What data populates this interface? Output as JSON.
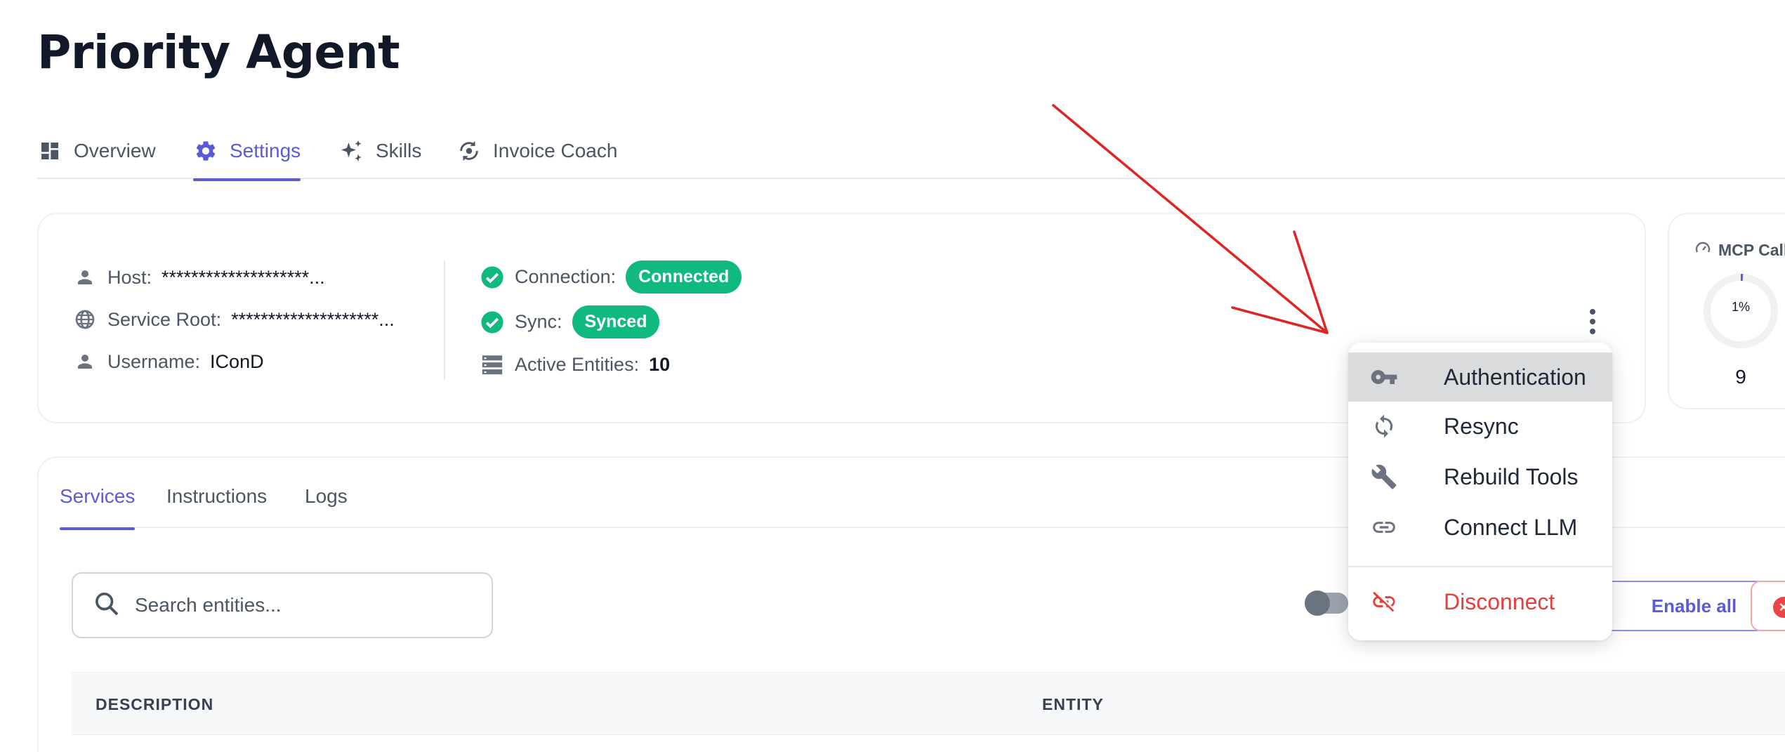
{
  "page": {
    "title": "Priority Agent"
  },
  "top_tabs": [
    {
      "label": "Overview",
      "icon": "dashboard-icon"
    },
    {
      "label": "Settings",
      "icon": "gear-icon",
      "active": true
    },
    {
      "label": "Skills",
      "icon": "sparkles-icon"
    },
    {
      "label": "Invoice Coach",
      "icon": "coach-icon"
    }
  ],
  "info": {
    "host_label": "Host:",
    "host_value": "********************...",
    "service_root_label": "Service Root:",
    "service_root_value": "********************...",
    "username_label": "Username:",
    "username_value": "IConD",
    "connection_label": "Connection:",
    "connection_status": "Connected",
    "sync_label": "Sync:",
    "sync_status": "Synced",
    "active_entities_label": "Active Entities:",
    "active_entities_value": "10"
  },
  "mcp": {
    "title": "MCP Call",
    "gauge_percent": "1%",
    "gauge_fraction": 0.01,
    "count": "9"
  },
  "menu": {
    "items": [
      {
        "label": "Authentication",
        "icon": "key-icon"
      },
      {
        "label": "Resync",
        "icon": "sync-icon"
      },
      {
        "label": "Rebuild Tools",
        "icon": "wrench-icon"
      },
      {
        "label": "Connect LLM",
        "icon": "link-icon"
      },
      {
        "label": "Disconnect",
        "icon": "link-off-icon"
      }
    ]
  },
  "sub_tabs": [
    {
      "label": "Services",
      "active": true
    },
    {
      "label": "Instructions"
    },
    {
      "label": "Logs"
    }
  ],
  "search": {
    "placeholder": "Search entities..."
  },
  "actions": {
    "enable_all": "Enable all"
  },
  "table": {
    "columns": [
      "DESCRIPTION",
      "ENTITY"
    ]
  },
  "colors": {
    "accent": "#5b5bd6",
    "success": "#10b981",
    "danger": "#e53e3e",
    "annotation_arrow": "#e02424"
  }
}
